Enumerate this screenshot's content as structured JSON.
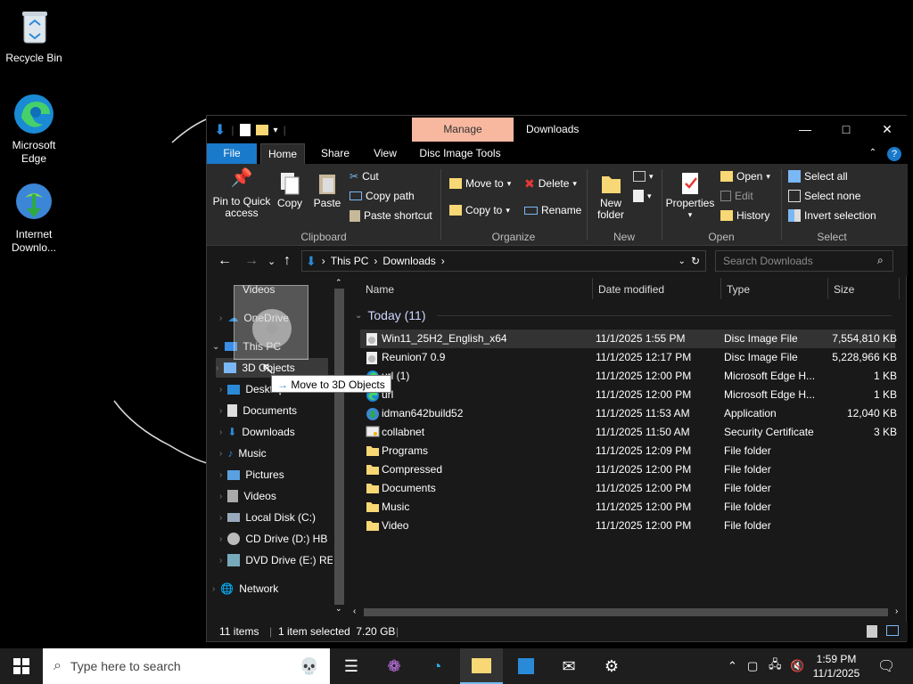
{
  "desktop": {
    "icons": [
      {
        "label": "Recycle Bin"
      },
      {
        "label": "Microsoft Edge"
      },
      {
        "label": "Internet Downlo..."
      }
    ]
  },
  "window": {
    "title": "Downloads",
    "manage_tab": "Manage",
    "tabs": [
      "File",
      "Home",
      "Share",
      "View",
      "Disc Image Tools"
    ],
    "ribbon": {
      "clipboard": {
        "pin": "Pin to Quick access",
        "copy": "Copy",
        "paste": "Paste",
        "cut": "Cut",
        "copy_path": "Copy path",
        "paste_shortcut": "Paste shortcut",
        "label": "Clipboard"
      },
      "organize": {
        "move_to": "Move to",
        "copy_to": "Copy to",
        "delete": "Delete",
        "rename": "Rename",
        "label": "Organize"
      },
      "new": {
        "new_folder": "New folder",
        "label": "New"
      },
      "open": {
        "properties": "Properties",
        "open": "Open",
        "edit": "Edit",
        "history": "History",
        "label": "Open"
      },
      "select": {
        "select_all": "Select all",
        "select_none": "Select none",
        "invert": "Invert selection",
        "label": "Select"
      }
    },
    "address": {
      "crumbs": [
        "This PC",
        "Downloads"
      ],
      "search_placeholder": "Search Downloads"
    },
    "nav": [
      {
        "label": "Videos"
      },
      {
        "label": "OneDrive"
      },
      {
        "label": "This PC"
      },
      {
        "label": "3D Objects"
      },
      {
        "label": "Desktop"
      },
      {
        "label": "Documents"
      },
      {
        "label": "Downloads"
      },
      {
        "label": "Music"
      },
      {
        "label": "Pictures"
      },
      {
        "label": "Videos"
      },
      {
        "label": "Local Disk (C:)"
      },
      {
        "label": "CD Drive (D:) HB"
      },
      {
        "label": "DVD Drive (E:) RE"
      },
      {
        "label": "Network"
      }
    ],
    "columns": [
      "Name",
      "Date modified",
      "Type",
      "Size"
    ],
    "group": "Today (11)",
    "files": [
      {
        "name": "Win11_25H2_English_x64",
        "date": "11/1/2025 1:55 PM",
        "type": "Disc Image File",
        "size": "7,554,810 KB",
        "icon": "disc-image-icon"
      },
      {
        "name": "Reunion7 0.9",
        "date": "11/1/2025 12:17 PM",
        "type": "Disc Image File",
        "size": "5,228,966 KB",
        "icon": "disc-image-icon"
      },
      {
        "name": "url (1)",
        "date": "11/1/2025 12:00 PM",
        "type": "Microsoft Edge H...",
        "size": "1 KB",
        "icon": "edge-html-icon"
      },
      {
        "name": "url",
        "date": "11/1/2025 12:00 PM",
        "type": "Microsoft Edge H...",
        "size": "1 KB",
        "icon": "edge-html-icon"
      },
      {
        "name": "idman642build52",
        "date": "11/1/2025 11:53 AM",
        "type": "Application",
        "size": "12,040 KB",
        "icon": "application-icon"
      },
      {
        "name": "collabnet",
        "date": "11/1/2025 11:50 AM",
        "type": "Security Certificate",
        "size": "3 KB",
        "icon": "certificate-icon"
      },
      {
        "name": "Programs",
        "date": "11/1/2025 12:09 PM",
        "type": "File folder",
        "size": "",
        "icon": "folder-icon"
      },
      {
        "name": "Compressed",
        "date": "11/1/2025 12:00 PM",
        "type": "File folder",
        "size": "",
        "icon": "folder-icon"
      },
      {
        "name": "Documents",
        "date": "11/1/2025 12:00 PM",
        "type": "File folder",
        "size": "",
        "icon": "folder-icon"
      },
      {
        "name": "Music",
        "date": "11/1/2025 12:00 PM",
        "type": "File folder",
        "size": "",
        "icon": "folder-icon"
      },
      {
        "name": "Video",
        "date": "11/1/2025 12:00 PM",
        "type": "File folder",
        "size": "",
        "icon": "folder-icon"
      }
    ],
    "status": {
      "items": "11 items",
      "selected": "1 item selected  7.20 GB"
    },
    "tooltip": "Move to 3D Objects"
  },
  "taskbar": {
    "search_placeholder": "Type here to search",
    "time": "1:59 PM",
    "date": "11/1/2025"
  },
  "colors": {
    "accent": "#1979ca",
    "manage": "#f8b8a0",
    "folder": "#f8d775"
  }
}
